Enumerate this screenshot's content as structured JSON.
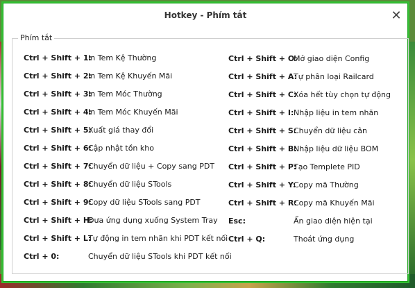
{
  "window": {
    "title": "Hotkey - Phím tắt",
    "close_glyph": "✕"
  },
  "group": {
    "legend": "Phím tắt"
  },
  "shortcuts_left": [
    {
      "key": "Ctrl + Shift + 1:",
      "desc": "In Tem Kệ Thường"
    },
    {
      "key": "Ctrl + Shift + 2:",
      "desc": "In Tem Kệ Khuyến Mãi"
    },
    {
      "key": "Ctrl + Shift + 3:",
      "desc": "In Tem Móc Thường"
    },
    {
      "key": "Ctrl + Shift + 4:",
      "desc": "In Tem Móc Khuyến Mãi"
    },
    {
      "key": "Ctrl + Shift + 5:",
      "desc": "Xuất giá thay đổi"
    },
    {
      "key": "Ctrl + Shift + 6:",
      "desc": "Cập nhật tồn kho"
    },
    {
      "key": "Ctrl + Shift + 7:",
      "desc": "Chuyển dữ liệu + Copy sang PDT"
    },
    {
      "key": "Ctrl + Shift + 8:",
      "desc": "Chuyển dữ liệu STools"
    },
    {
      "key": "Ctrl + Shift + 9:",
      "desc": "Copy dữ liệu STools sang PDT"
    },
    {
      "key": "Ctrl + Shift + H:",
      "desc": "Đưa ứng dụng xuống System Tray"
    },
    {
      "key": "Ctrl + Shift + L:",
      "desc": "Tự động in tem nhãn khi PDT kết nối"
    },
    {
      "key": "Ctrl + 0:",
      "desc": "Chuyển dữ liệu STools khi PDT kết nối"
    }
  ],
  "shortcuts_right": [
    {
      "key": "Ctrl + Shift + O:",
      "desc": "Mở giao diện Config"
    },
    {
      "key": "Ctrl + Shift + A:",
      "desc": "Tự phân loại Railcard"
    },
    {
      "key": "Ctrl + Shift + C:",
      "desc": "Xóa hết tùy chọn tự động"
    },
    {
      "key": "Ctrl + Shift + I:",
      "desc": "Nhập liệu in tem nhãn"
    },
    {
      "key": "Ctrl + Shift + S:",
      "desc": "Chuyển dữ liệu cân"
    },
    {
      "key": "Ctrl + Shift + B:",
      "desc": "Nhập liệu dữ liệu BOM"
    },
    {
      "key": "Ctrl + Shift + P:",
      "desc": "Tạo Templete PID"
    },
    {
      "key": "Ctrl + Shift + Y:",
      "desc": "Copy mã Thường"
    },
    {
      "key": "Ctrl + Shift + R:",
      "desc": "Copy mã Khuyến Mãi"
    },
    {
      "key": "Esc:",
      "desc": "Ẩn giao diện hiện tại"
    },
    {
      "key": "Ctrl + Q:",
      "desc": "Thoát ứng dụng"
    }
  ]
}
